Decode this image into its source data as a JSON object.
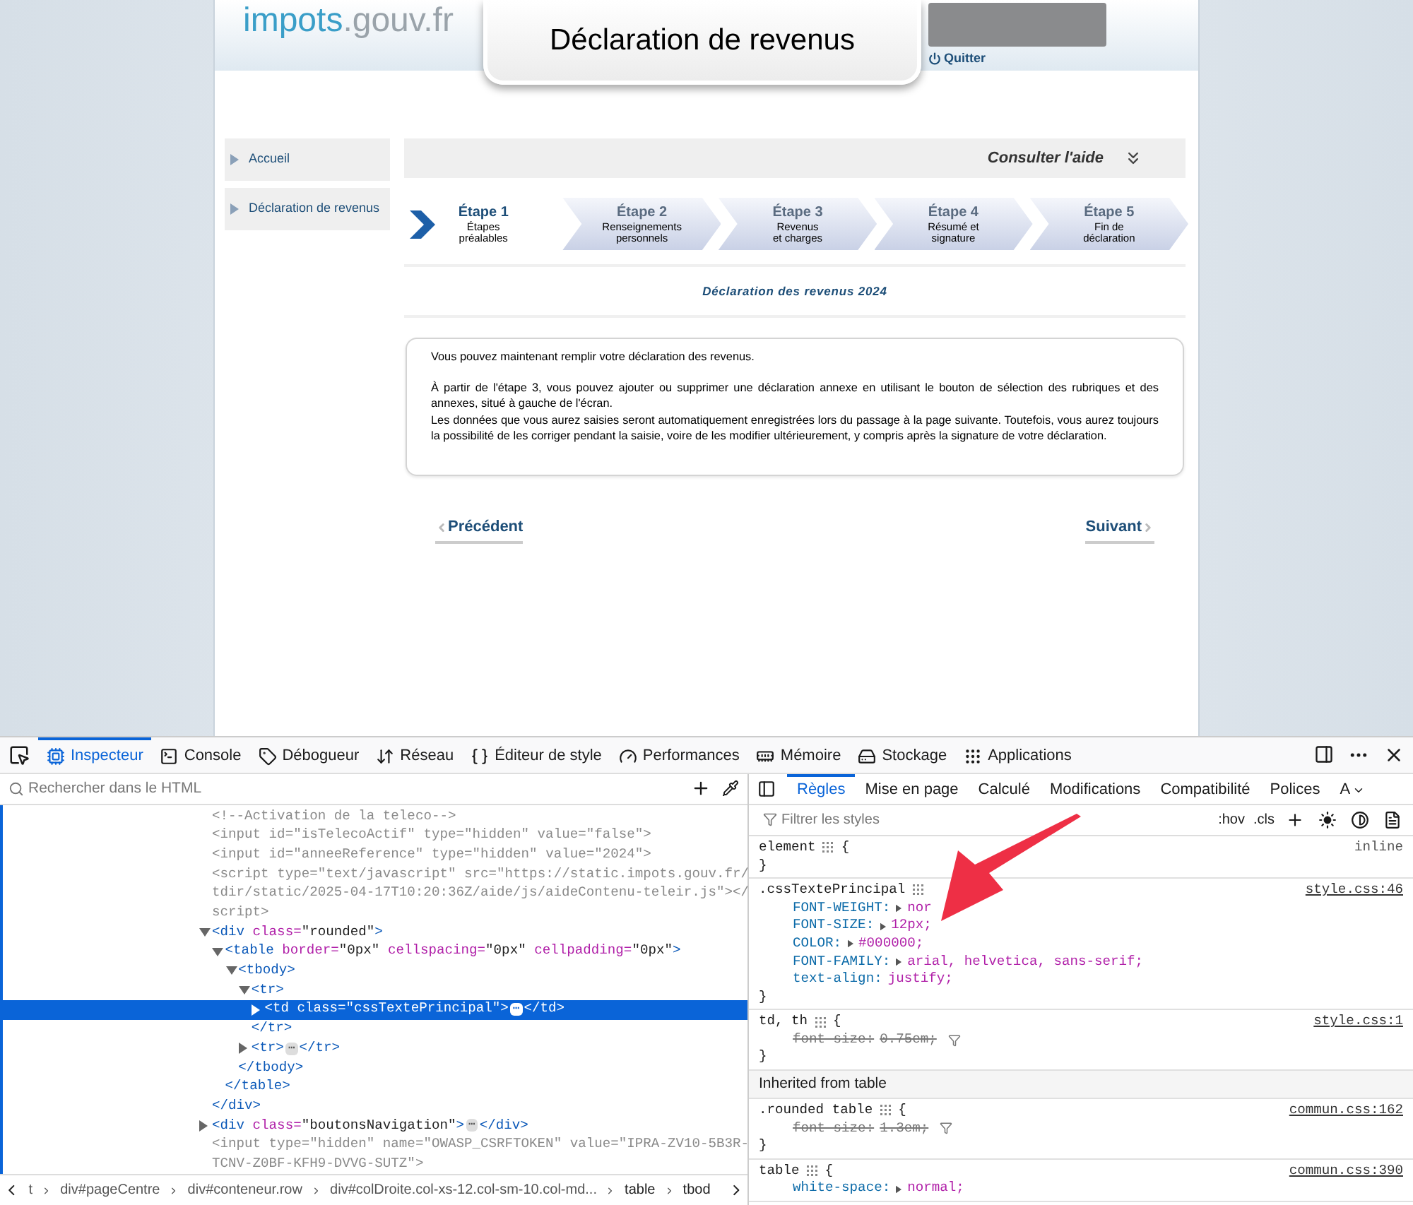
{
  "page": {
    "logo": {
      "main": "impots",
      "domain": ".gouv.fr"
    },
    "title": "Déclaration de revenus",
    "quit": "Quitter",
    "sidebar": [
      {
        "label": "Accueil"
      },
      {
        "label": "Déclaration de revenus"
      }
    ],
    "help": "Consulter l'aide",
    "steps": [
      {
        "title": "Étape 1",
        "lines": [
          "Étapes",
          "préalables"
        ],
        "selected": true
      },
      {
        "title": "Étape 2",
        "lines": [
          "Renseignements",
          "personnels"
        ],
        "selected": false
      },
      {
        "title": "Étape 3",
        "lines": [
          "Revenus",
          "et charges"
        ],
        "selected": false
      },
      {
        "title": "Étape 4",
        "lines": [
          "Résumé et",
          "signature"
        ],
        "selected": false
      },
      {
        "title": "Étape 5",
        "lines": [
          "Fin de",
          "déclaration"
        ],
        "selected": false
      }
    ],
    "section_title": "Déclaration des revenus 2024",
    "blocks": [
      [
        "Vous pouvez maintenant remplir votre déclaration des revenus."
      ],
      [
        "À partir de l'étape 3, vous pouvez ajouter ou supprimer une déclaration annexe en utilisant le bouton de sélection des rubriques et des annexes, situé à gauche de l'écran.",
        "Les données que vous aurez saisies seront automatiquement enregistrées lors du passage à la page suivante. Toutefois, vous aurez toujours la possibilité de les corriger pendant la saisie, voire de les modifier ultérieurement, y compris après la signature de votre déclaration."
      ]
    ],
    "previous": "Précédent",
    "next": "Suivant"
  },
  "devtools": {
    "tools": [
      {
        "label": "Inspecteur",
        "kind": "inspector",
        "selected": true
      },
      {
        "label": "Console",
        "kind": "console",
        "selected": false
      },
      {
        "label": "Débogueur",
        "kind": "debugger",
        "selected": false
      },
      {
        "label": "Réseau",
        "kind": "network",
        "selected": false
      },
      {
        "label": "Éditeur de style",
        "kind": "style",
        "selected": false
      },
      {
        "label": "Performances",
        "kind": "performance",
        "selected": false
      },
      {
        "label": "Mémoire",
        "kind": "memory",
        "selected": false
      },
      {
        "label": "Stockage",
        "kind": "storage",
        "selected": false
      },
      {
        "label": "Applications",
        "kind": "applications",
        "selected": false
      }
    ],
    "search_placeholder": "Rechercher dans le HTML",
    "markup": [
      {
        "text": "<!--Activation de la teleco-->",
        "kind": "line",
        "dimmed": true,
        "selected": false
      },
      {
        "text": "<input id=\"isTelecoActif\" type=\"hidden\" value=\"false\">",
        "kind": "line",
        "dimmed": true,
        "selected": false
      },
      {
        "text": "<input id=\"anneeReference\" type=\"hidden\" value=\"2024\">",
        "kind": "line",
        "dimmed": true,
        "selected": false
      },
      {
        "text": "<script type=\"text/javascript\" src=\"https://static.impots.gouv.fr/",
        "kind": "line",
        "dimmed": true,
        "selected": false
      },
      {
        "text": "tdir/static/2025-04-17T10:20:36Z/aide/js/aideContenu-teleir.js\"></",
        "kind": "line",
        "dimmed": true,
        "selected": false
      },
      {
        "text": "script>",
        "kind": "line",
        "dimmed": true,
        "selected": false
      },
      {
        "text": "<div class=\"rounded\">",
        "kind": "node",
        "expanded": true,
        "dimmed": false,
        "selected": false,
        "children": [
          {
            "text": "<table border=\"0px\" cellspacing=\"0px\" cellpadding=\"0px\">",
            "kind": "node",
            "expanded": true,
            "dimmed": false,
            "selected": false,
            "children": [
              {
                "text": "<tbody>",
                "kind": "node",
                "expanded": true,
                "dimmed": false,
                "selected": false,
                "children": [
                  {
                    "text": "<tr>",
                    "kind": "node",
                    "expanded": true,
                    "dimmed": false,
                    "selected": false,
                    "children": [
                      {
                        "text": "<td class=\"cssTextePrincipal\">",
                        "badge": "⋯",
                        "close": "</td>",
                        "kind": "node",
                        "expanded": false,
                        "dimmed": false,
                        "selected": true
                      }
                    ]
                  },
                  {
                    "text": "</tr>",
                    "kind": "line",
                    "dimmed": false,
                    "selected": false
                  },
                  {
                    "text": "<tr>",
                    "badge": "⋯",
                    "close": "</tr>",
                    "kind": "node",
                    "expanded": false,
                    "dimmed": false,
                    "selected": false
                  }
                ]
              },
              {
                "text": "</tbody>",
                "kind": "line",
                "dimmed": false,
                "selected": false
              }
            ]
          },
          {
            "text": "</table>",
            "kind": "line",
            "dimmed": false,
            "selected": false
          }
        ]
      },
      {
        "text": "</div>",
        "kind": "line",
        "dimmed": false,
        "selected": false
      },
      {
        "text": "<div class=\"boutonsNavigation\">",
        "badge": "⋯",
        "close": "</div>",
        "kind": "node",
        "expanded": false,
        "dimmed": false,
        "selected": false
      },
      {
        "text": "<input type=\"hidden\" name=\"OWASP_CSRFTOKEN\" value=\"IPRA-ZV10-5B3R-",
        "kind": "line",
        "dimmed": true,
        "selected": false
      },
      {
        "text": "TCNV-Z0BF-KFH9-DVVG-SUTZ\">",
        "kind": "line",
        "dimmed": true,
        "selected": false
      }
    ],
    "breadcrumbs": [
      "t",
      "div#pageCentre",
      "div#conteneur.row",
      "div#colDroite.col-xs-12.col-sm-10.col-md...",
      "table",
      "tbod"
    ],
    "side_tabs": [
      {
        "label": "Règles",
        "selected": true
      },
      {
        "label": "Mise en page",
        "selected": false
      },
      {
        "label": "Calculé",
        "selected": false
      },
      {
        "label": "Modifications",
        "selected": false
      },
      {
        "label": "Compatibilité",
        "selected": false
      },
      {
        "label": "Polices",
        "selected": false
      },
      {
        "label": "A",
        "selected": false
      }
    ],
    "filter_placeholder": "Filtrer les styles",
    "hov": ":hov",
    "cls": ".cls",
    "rules": [
      {
        "kind": "rule",
        "selector": "element",
        "brace": "{",
        "source": "inline",
        "close": "}"
      },
      {
        "kind": "rule",
        "selector": ".cssTextePrincipal",
        "source": "style.css:46",
        "close": "}",
        "declarations": [
          {
            "prop": "FONT-WEIGHT:",
            "value": "nor",
            "expandable": true,
            "overridden": false
          },
          {
            "prop": "FONT-SIZE:",
            "value": "12px;",
            "expandable": true,
            "overridden": false
          },
          {
            "prop": "COLOR:",
            "value": "#000000;",
            "expandable": true,
            "overridden": false
          },
          {
            "prop": "FONT-FAMILY:",
            "value": "arial, helvetica, sans-serif;",
            "expandable": true,
            "overridden": false
          },
          {
            "prop": "text-align:",
            "value": "justify;",
            "expandable": false,
            "overridden": false
          }
        ]
      },
      {
        "kind": "rule",
        "selector": "td, th",
        "brace": "{",
        "source": "style.css:1",
        "close": "}",
        "declarations": [
          {
            "prop": "font-size:",
            "value": "0.75em;",
            "expandable": false,
            "overridden": true
          }
        ]
      },
      {
        "kind": "header",
        "selector": "Inherited from table"
      },
      {
        "kind": "rule",
        "selector": ".rounded table",
        "brace": "{",
        "source": "commun.css:162",
        "close": "}",
        "declarations": [
          {
            "prop": "font-size:",
            "value": "1.3em;",
            "expandable": false,
            "overridden": true
          }
        ]
      },
      {
        "kind": "rule",
        "selector": "table",
        "brace": "{",
        "source": "commun.css:390",
        "declarations": [
          {
            "prop": "white-space:",
            "value": "normal;",
            "expandable": true,
            "overridden": false
          }
        ]
      }
    ]
  }
}
